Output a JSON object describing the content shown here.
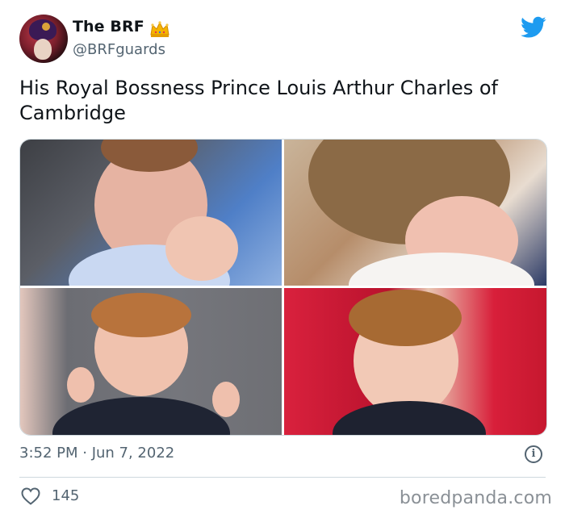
{
  "author": {
    "display_name": "The BRF",
    "handle": "@BRFguards",
    "badge_icon": "crown-icon",
    "avatar_icon": "avatar-guard-icon"
  },
  "platform_icon": "twitter-bird-icon",
  "tweet": {
    "text": "His Royal Bossness Prince Louis Arthur Charles of Cambridge",
    "photos": [
      "photo-1",
      "photo-2",
      "photo-3",
      "photo-4"
    ]
  },
  "meta": {
    "timestamp": "3:52 PM · Jun 7, 2022",
    "info_icon": "info-icon"
  },
  "engagement": {
    "likes": "145",
    "like_icon": "heart-icon"
  },
  "watermark": "boredpanda.com",
  "colors": {
    "accent": "#1d9bf0",
    "text_primary": "#0f1419",
    "text_secondary": "#536471",
    "border": "#cfd9de",
    "crown": "#f5b400"
  }
}
